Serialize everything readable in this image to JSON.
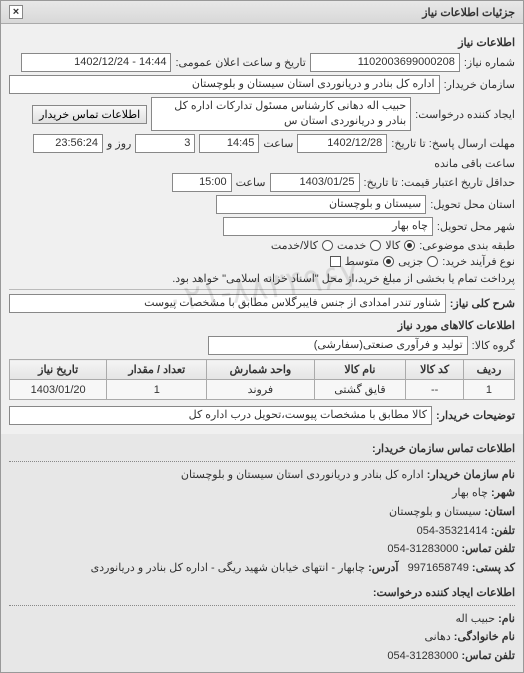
{
  "window": {
    "title": "جزئیات اطلاعات نیاز",
    "close": "×"
  },
  "panel_title": "اطلاعات نیاز",
  "fields": {
    "need_no_label": "شماره نیاز:",
    "need_no": "1102003699000208",
    "announce_label": "تاریخ و ساعت اعلان عمومی:",
    "announce": "14:44 - 1402/12/24",
    "buyer_org_label": "سازمان خریدار:",
    "buyer_org": "اداره کل بنادر و دریانوردی استان سیستان و بلوچستان",
    "requester_label": "ایجاد کننده درخواست:",
    "requester": "حبیب اله دهانی کارشناس مسئول تدارکات اداره کل بنادر و دریانوردی استان س",
    "btn_buyer_contact": "اطلاعات تماس خریدار",
    "deadline_to_label": "مهلت ارسال پاسخ: تا تاریخ:",
    "deadline_date": "1402/12/28",
    "hour_label": "ساعت",
    "deadline_time": "14:45",
    "days_remain": "3",
    "days_remain_suffix": "روز و",
    "time_remain": "23:56:24",
    "time_remain_suffix": "ساعت باقی مانده",
    "delivery_to_label": "حداقل تاریخ اعتبار قیمت: تا تاریخ:",
    "delivery_date": "1403/01/25",
    "delivery_time": "15:00",
    "province_label": "استان محل تحویل:",
    "province": "سیستان و بلوچستان",
    "city_label": "شهر محل تحویل:",
    "city": "چاه بهار",
    "cat_label": "طبقه بندی موضوعی:",
    "cat_goods": "کالا",
    "cat_service": "خدمت",
    "cat_goodsservice": "کالا/خدمت",
    "proc_label": "نوع فرآیند خرید:",
    "proc_small": "جزیی",
    "proc_mid": "متوسط",
    "proc_note": "پرداخت تمام یا بخشی از مبلغ خرید،از محل \"اسناد خزانه اسلامی\" خواهد بود.",
    "need_title_label": "شرح کلی نیاز:",
    "need_title": "شناور تندر امدادی از جنس فایبرگلاس مطابق با مشخصات پیوست",
    "goods_header": "اطلاعات کالاهای مورد نیاز",
    "group_label": "گروه کالا:",
    "group": "تولید و فرآوری صنعتی(سفارشی)"
  },
  "table": {
    "headers": [
      "ردیف",
      "کد کالا",
      "نام کالا",
      "واحد شمارش",
      "تعداد / مقدار",
      "تاریخ نیاز"
    ],
    "rows": [
      {
        "idx": "1",
        "code": "--",
        "name": "قایق گشتی",
        "unit": "فروند",
        "qty": "1",
        "date": "1403/01/20"
      }
    ]
  },
  "buyer_note_label": "توضیحات خریدار:",
  "buyer_note": "کالا مطابق با مشخصات پیوست،تحویل درب اداره کل",
  "watermark": "۰۲۱-۸۸۳۴۹۶۷",
  "contact": {
    "header": "اطلاعات تماس سازمان خریدار:",
    "org_label": "نام سازمان خریدار:",
    "org": "اداره کل بنادر و دریانوردی استان سیستان و بلوچستان",
    "city_label": "شهر:",
    "city": "چاه بهار",
    "province_label": "استان:",
    "province": "سیستان و بلوچستان",
    "phone_label": "تلفن:",
    "phone": "35321414-054",
    "fax_label": "تلفن تماس:",
    "fax": "31283000-054",
    "postal_label": "کد پستی:",
    "postal": "9971658749",
    "address_label": "آدرس:",
    "address": "چابهار - انتهای خیابان شهید ریگی - اداره کل بنادر و دریانوردی",
    "req_header": "اطلاعات ایجاد کننده درخواست:",
    "req_name_label": "نام:",
    "req_name": "حبیب اله",
    "req_family_label": "نام خانوادگی:",
    "req_family": "دهانی",
    "req_phone_label": "تلفن تماس:",
    "req_phone": "31283000-054"
  }
}
